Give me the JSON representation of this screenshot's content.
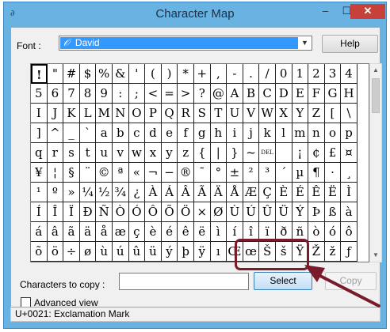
{
  "window": {
    "title": "Character Map",
    "app_icon": "∂",
    "controls": {
      "minimize": "–",
      "maximize": "☐",
      "close": "✕"
    }
  },
  "font": {
    "label": "Font :",
    "icon": "𝒪",
    "selected": "David",
    "arrow": "▼"
  },
  "buttons": {
    "help": "Help",
    "select": "Select",
    "copy": "Copy"
  },
  "copy": {
    "label": "Characters to copy :",
    "value": ""
  },
  "advanced": {
    "label": "Advanced view",
    "checked": false
  },
  "status": "U+0021: Exclamation Mark",
  "scrollbar": {
    "up": "▲",
    "down": "▼"
  },
  "highlight_color": "#7a1b2b",
  "selection_index": 0,
  "characters": [
    "!",
    "\"",
    "#",
    "$",
    "%",
    "&",
    "'",
    "(",
    ")",
    "*",
    "+",
    ",",
    "-",
    ".",
    "/",
    "0",
    "1",
    "2",
    "3",
    "4",
    "5",
    "6",
    "7",
    "8",
    "9",
    ":",
    ";",
    "<",
    "=",
    ">",
    "?",
    "@",
    "A",
    "B",
    "C",
    "D",
    "E",
    "F",
    "G",
    "H",
    "I",
    "J",
    "K",
    "L",
    "M",
    "N",
    "O",
    "P",
    "Q",
    "R",
    "S",
    "T",
    "U",
    "V",
    "W",
    "X",
    "Y",
    "Z",
    "[",
    "\\",
    "]",
    "^",
    "_",
    "`",
    "a",
    "b",
    "c",
    "d",
    "e",
    "f",
    "g",
    "h",
    "i",
    "j",
    "k",
    "l",
    "m",
    "n",
    "o",
    "p",
    "q",
    "r",
    "s",
    "t",
    "u",
    "v",
    "w",
    "x",
    "y",
    "z",
    "{",
    "|",
    "}",
    "~",
    "DEL",
    "",
    "¡",
    "¢",
    "£",
    "¤",
    "¥",
    "¦",
    "§",
    "¨",
    "©",
    "ª",
    "«",
    "¬",
    "−",
    "®",
    "¯",
    "°",
    "±",
    "²",
    "³",
    "´",
    "µ",
    "¶",
    "·",
    "¸",
    "¹",
    "º",
    "»",
    "¼",
    "½",
    "¾",
    "¿",
    "À",
    "Á",
    "Â",
    "Ã",
    "Ä",
    "Å",
    "Æ",
    "Ç",
    "È",
    "É",
    "Ê",
    "Ë",
    "Ì",
    "Í",
    "Î",
    "Ï",
    "Ð",
    "Ñ",
    "Ò",
    "Ó",
    "Ô",
    "Õ",
    "Ö",
    "×",
    "Ø",
    "Ù",
    "Ú",
    "Û",
    "Ü",
    "Ý",
    "Þ",
    "ß",
    "à",
    "á",
    "â",
    "ã",
    "ä",
    "å",
    "æ",
    "ç",
    "è",
    "é",
    "ê",
    "ë",
    "ì",
    "í",
    "î",
    "ï",
    "ð",
    "ñ",
    "ò",
    "ó",
    "ô",
    "õ",
    "ö",
    "÷",
    "ø",
    "ù",
    "ú",
    "û",
    "ü",
    "ý",
    "þ",
    "ÿ",
    "ı",
    "Œ",
    "œ",
    "Š",
    "š",
    "Ÿ",
    "Ž",
    "ž",
    "ƒ"
  ]
}
